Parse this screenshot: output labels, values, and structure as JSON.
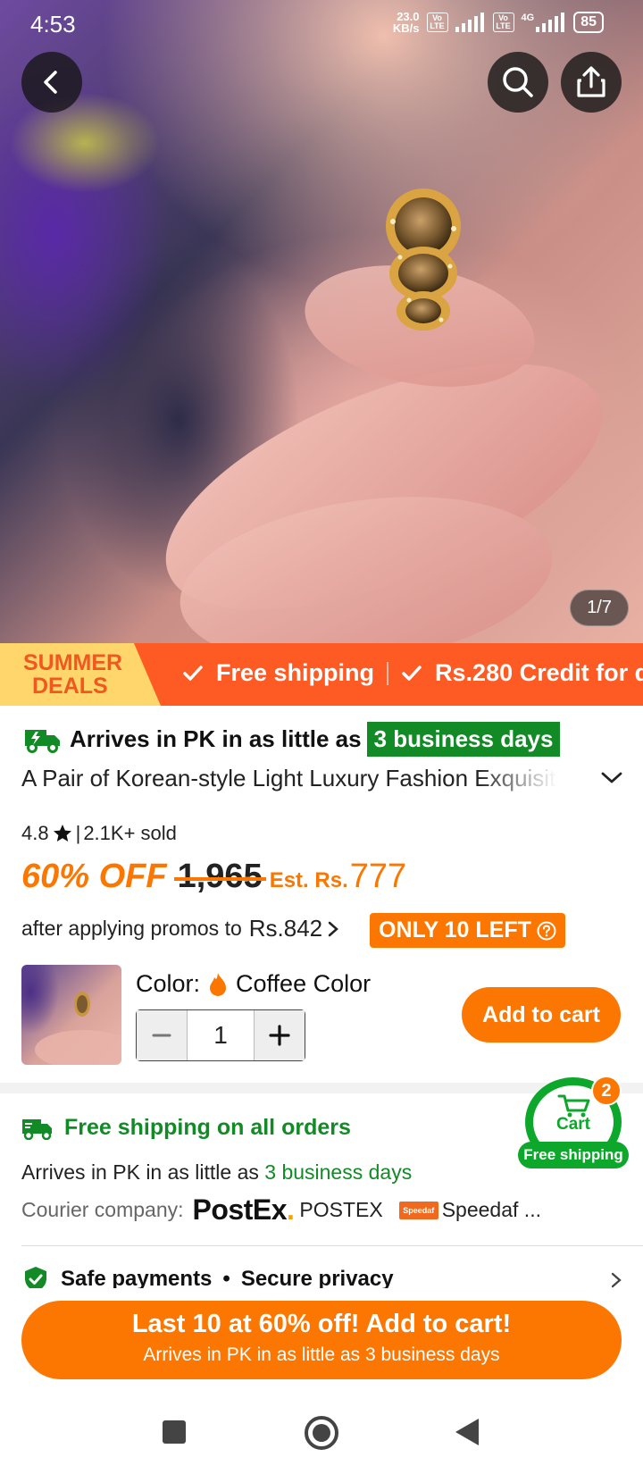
{
  "status_bar": {
    "time": "4:53",
    "net_speed_value": "23.0",
    "net_speed_unit": "KB/s",
    "network": "4G",
    "volte_1": "Vo LTE",
    "volte_2": "Vo LTE",
    "battery": "85"
  },
  "gallery": {
    "counter": "1/7"
  },
  "promo_banner": {
    "deals_line1": "SUMMER",
    "deals_line2": "DEALS",
    "item1": "Free shipping",
    "item2": "Rs.280 Credit for d"
  },
  "delivery": {
    "arrives_text": "Arrives in PK in as little as",
    "arrives_days": "3 business days"
  },
  "product": {
    "title": "A Pair of Korean-style Light Luxury Fashion Exquisite",
    "rating": "4.8",
    "sep": "|",
    "sold": "2.1K+ sold",
    "discount": "60% OFF",
    "original_price": "1,965",
    "est_label": "Est. Rs.",
    "est_price": "777",
    "promo_text": "after applying promos to",
    "promo_price": "Rs.842",
    "stock_badge": "ONLY 10 LEFT",
    "color_label": "Color:",
    "color_value": "Coffee Color",
    "quantity": "1",
    "add_to_cart": "Add to cart"
  },
  "shipping": {
    "title": "Free shipping on all orders",
    "arrives_prefix": "Arrives in PK in as little as",
    "arrives_days": "3 business days",
    "courier_label": "Courier company:",
    "postex_logo": "PostEx",
    "postex_name": "POSTEX",
    "speedaf_logo": "Speedaf",
    "speedaf_name": "Speedaf ..."
  },
  "safe": {
    "item1": "Safe payments",
    "dot": "•",
    "item2": "Secure privacy"
  },
  "cart_float": {
    "badge": "2",
    "label": "Cart",
    "free_shipping": "Free shipping"
  },
  "cta": {
    "line1": "Last 10 at 60% off! Add to cart!",
    "line2": "Arrives in PK in as little as 3 business days"
  },
  "colors": {
    "accent": "#fb7701",
    "banner": "#fe5a24",
    "green": "#128a26",
    "cart_green": "#0da82b"
  }
}
